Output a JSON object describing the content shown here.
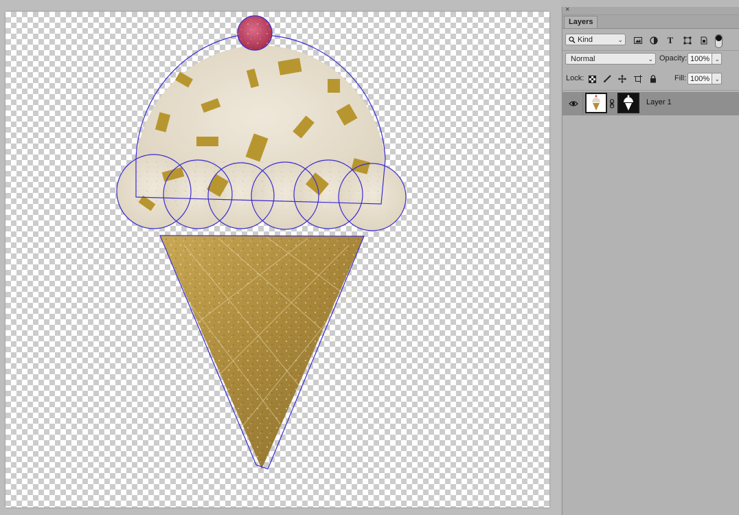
{
  "panel": {
    "close_glyph": "×",
    "tab_label": "Layers",
    "filter": {
      "kind_label": "Kind"
    },
    "blend": {
      "mode": "Normal",
      "opacity_label": "Opacity:",
      "opacity_value": "100%"
    },
    "lock": {
      "label": "Lock:",
      "fill_label": "Fill:",
      "fill_value": "100%"
    },
    "layers": [
      {
        "name": "Layer 1",
        "visible": true
      }
    ]
  },
  "colors": {
    "selection_outline": "#3a2bd0",
    "scoop": "#e8e0d0",
    "cone": "#b09040",
    "cherry": "#c8476a",
    "selected_layer_bg": "#8f8f8f"
  }
}
